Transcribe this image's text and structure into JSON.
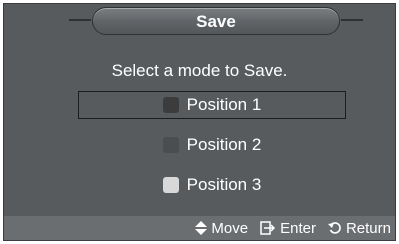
{
  "dialog": {
    "title": "Save",
    "prompt": "Select a mode to Save.",
    "options": [
      {
        "label": "Position 1",
        "color": "#3c3c3c",
        "selected": true
      },
      {
        "label": "Position 2",
        "color": "#4b4e51",
        "selected": false
      },
      {
        "label": "Position 3",
        "color": "#d8d8d8",
        "selected": false
      }
    ]
  },
  "footer": {
    "move_label": "Move",
    "move_icon": "up-down-arrows-icon",
    "enter_label": "Enter",
    "enter_icon": "enter-icon",
    "return_label": "Return",
    "return_icon": "return-arrow-icon"
  }
}
